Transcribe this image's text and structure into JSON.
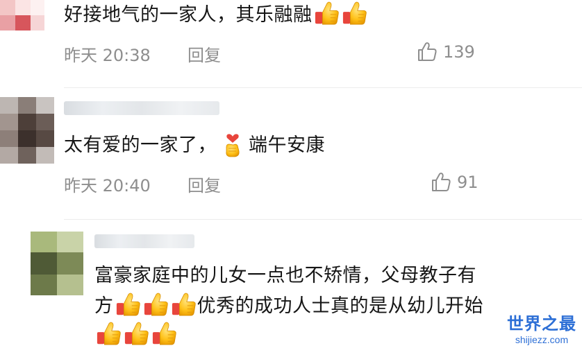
{
  "comments": [
    {
      "text": "好接地气的一家人，其乐融融",
      "emojis": [
        "thumbs-up",
        "thumbs-up"
      ],
      "time": "昨天 20:38",
      "reply_label": "回复",
      "likes": "139"
    },
    {
      "text_before": "太有爱的一家了，",
      "emoji": "finger-heart",
      "text_after": "端午安康",
      "time": "昨天 20:40",
      "reply_label": "回复",
      "likes": "91"
    },
    {
      "line1": "富豪家庭中的儿女一点也不矫情，父母教子有",
      "line2_before": "方",
      "line2_after": "优秀的成功人士真的是从幼儿开始",
      "emojis": [
        "thumbs-up",
        "thumbs-up",
        "thumbs-up",
        "thumbs-up",
        "thumbs-up",
        "thumbs-up"
      ]
    }
  ],
  "watermark": {
    "title": "世界之最",
    "url": "shijiezz.com"
  },
  "colors": {
    "meta_text": "#8e8e8e",
    "body_text": "#161616",
    "watermark": "#2d6fd6"
  }
}
